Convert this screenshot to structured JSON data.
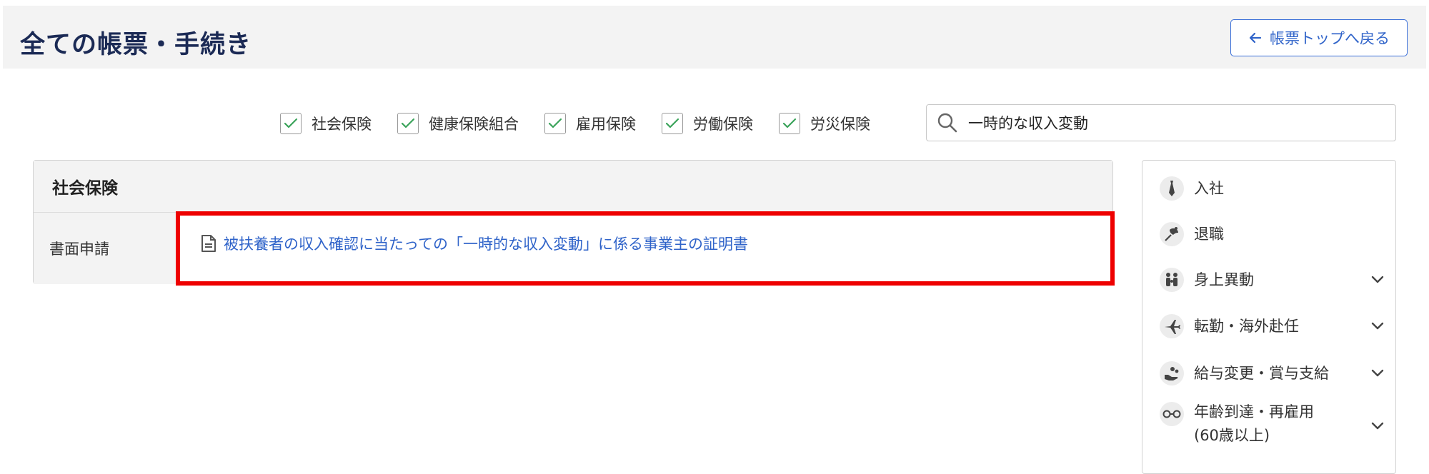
{
  "header": {
    "title": "全ての帳票・手続き",
    "back_label": "帳票トップへ戻る"
  },
  "filters": [
    {
      "label": "社会保険",
      "checked": true
    },
    {
      "label": "健康保険組合",
      "checked": true
    },
    {
      "label": "雇用保険",
      "checked": true
    },
    {
      "label": "労働保険",
      "checked": true
    },
    {
      "label": "労災保険",
      "checked": true
    }
  ],
  "search": {
    "value": "一時的な収入変動"
  },
  "results": {
    "category": "社会保険",
    "row_label": "書面申請",
    "link_text": "被扶養者の収入確認に当たっての「一時的な収入変動」に係る事業主の証明書"
  },
  "sidebar": {
    "items": [
      {
        "label": "入社",
        "icon": "tie-icon",
        "expandable": false
      },
      {
        "label": "退職",
        "icon": "bouquet-icon",
        "expandable": false
      },
      {
        "label": "身上異動",
        "icon": "family-icon",
        "expandable": true
      },
      {
        "label": "転勤・海外赴任",
        "icon": "airplane-icon",
        "expandable": true
      },
      {
        "label": "給与変更・賞与支給",
        "icon": "coins-hand-icon",
        "expandable": true
      },
      {
        "label": "年齢到達・再雇用",
        "label2": "(60歳以上)",
        "icon": "glasses-icon",
        "expandable": true
      }
    ]
  },
  "colors": {
    "accent": "#2f63c9",
    "check": "#3aa35a",
    "highlight": "#ee0000",
    "title": "#1b2a55"
  }
}
